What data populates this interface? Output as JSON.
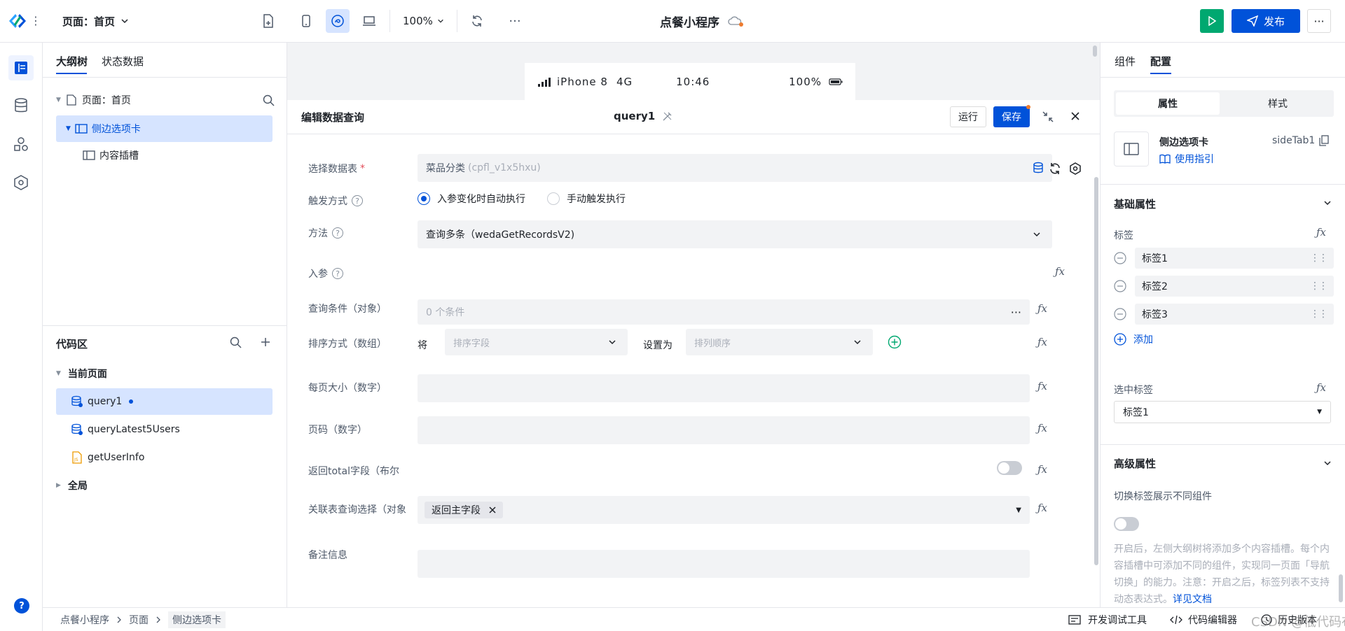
{
  "topbar": {
    "page_selector": "页面：首页",
    "zoom": "100%",
    "app_title": "点餐小程序",
    "publish_label": "发布"
  },
  "left_panel": {
    "tabs": [
      "大纲树",
      "状态数据"
    ],
    "tree": {
      "root": "页面：首页",
      "child": "侧边选项卡",
      "grandchild": "内容插槽"
    },
    "code_area": {
      "title": "代码区",
      "current_page": "当前页面",
      "items": [
        "query1",
        "queryLatest5Users",
        "getUserInfo"
      ],
      "global": "全局"
    }
  },
  "device_bar": {
    "device": "iPhone 8",
    "network": "4G",
    "time": "10:46",
    "battery": "100%"
  },
  "query_editor": {
    "title": "编辑数据查询",
    "query_name": "query1",
    "run_label": "运行",
    "save_label": "保存",
    "fields": {
      "table_label": "选择数据表",
      "table_required": "*",
      "table_value": "菜品分类",
      "table_id": "(cpfl_v1x5hxu)",
      "trigger_label": "触发方式",
      "trigger_auto": "入参变化时自动执行",
      "trigger_manual": "手动触发执行",
      "method_label": "方法",
      "method_value": "查询多条（wedaGetRecordsV2)",
      "params_label": "入参",
      "query_cond_label": "查询条件（对象）",
      "query_cond_value": "0 个条件",
      "sort_label": "排序方式（数组）",
      "sort_prefix": "将",
      "sort_field_placeholder": "排序字段",
      "sort_set_as": "设置为",
      "sort_order_placeholder": "排列顺序",
      "page_size_label": "每页大小（数字）",
      "page_num_label": "页码（数字）",
      "return_total_label": "返回total字段（布尔",
      "join_label": "关联表查询选择（对象",
      "join_tag": "返回主字段",
      "remark_label": "备注信息"
    }
  },
  "right_panel": {
    "tabs": [
      "组件",
      "配置"
    ],
    "subtabs": [
      "属性",
      "样式"
    ],
    "component_name": "侧边选项卡",
    "component_id": "sideTab1",
    "guide_link": "使用指引",
    "basic_section": "基础属性",
    "tags_label": "标签",
    "tags": [
      "标签1",
      "标签2",
      "标签3"
    ],
    "add_label": "添加",
    "selected_tag_label": "选中标签",
    "selected_tag_value": "标签1",
    "advanced_section": "高级属性",
    "switch_label": "切换标签展示不同组件",
    "description": "开启后，左侧大纲树将添加多个内容插槽。每个内容插槽中可添加不同的组件，实现同一页面「导航切换」的能力。注意：开启之后，标签列表不支持动态表达式。",
    "doc_link": "详见文档"
  },
  "statusbar": {
    "breadcrumbs": [
      "点餐小程序",
      "页面",
      "侧边选项卡"
    ],
    "dev_tools": "开发调试工具",
    "code_editor": "代码编辑器",
    "history": "历史版本",
    "watermark": "CSDN @低代码布道师"
  },
  "colors": {
    "accent": "#0052d9",
    "run_green": "#00a870",
    "selected_bg": "#d6e4ff"
  }
}
